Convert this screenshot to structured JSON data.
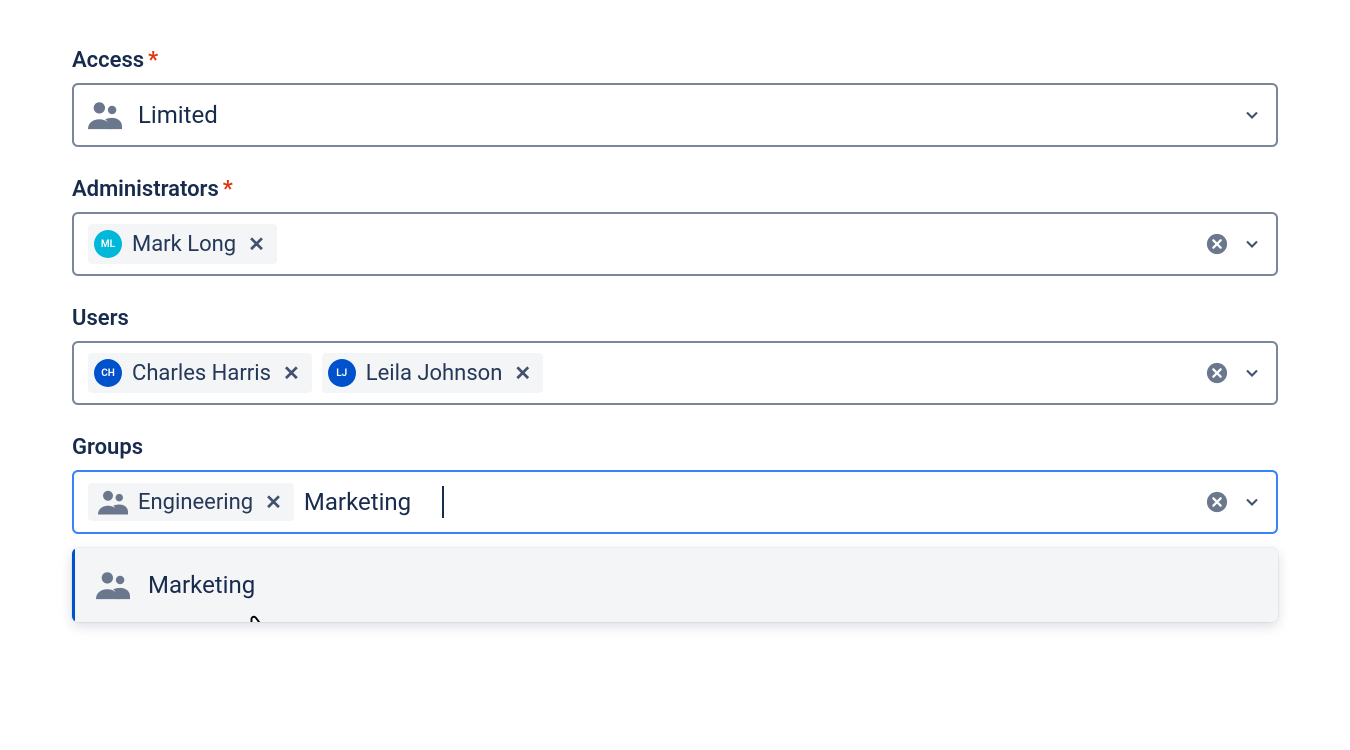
{
  "access": {
    "label": "Access",
    "required_mark": "*",
    "value": "Limited"
  },
  "administrators": {
    "label": "Administrators",
    "required_mark": "*",
    "chips": [
      {
        "initials": "ML",
        "name": "Mark Long",
        "color": "teal"
      }
    ]
  },
  "users": {
    "label": "Users",
    "chips": [
      {
        "initials": "CH",
        "name": "Charles Harris",
        "color": "blue"
      },
      {
        "initials": "LJ",
        "name": "Leila Johnson",
        "color": "blue"
      }
    ]
  },
  "groups": {
    "label": "Groups",
    "chips": [
      {
        "name": "Engineering"
      }
    ],
    "input_value": "Marketing",
    "dropdown": [
      {
        "name": "Marketing",
        "highlight": true
      }
    ]
  }
}
